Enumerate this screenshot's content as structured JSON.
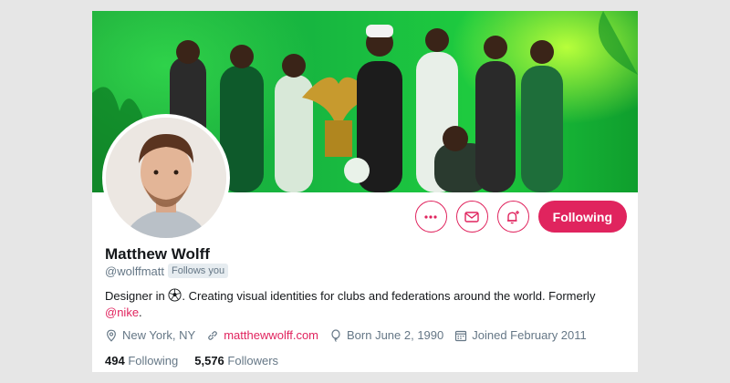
{
  "profile": {
    "name": "Matthew Wolff",
    "handle": "@wolffmatt",
    "follows_you": "Follows you",
    "bio_prefix": "Designer in",
    "bio_suffix": ". Creating visual identities for clubs and federations around the world. Formerly",
    "bio_mention": "@nike",
    "bio_end": "."
  },
  "actions": {
    "more_icon": "more-icon",
    "message_icon": "envelope-icon",
    "notify_icon": "bell-plus-icon",
    "follow_label": "Following"
  },
  "meta": {
    "location": "New York, NY",
    "website": "matthewwolff.com",
    "born": "Born June 2, 1990",
    "joined": "Joined February 2011"
  },
  "stats": {
    "following_count": "494",
    "following_label": "Following",
    "followers_count": "5,576",
    "followers_label": "Followers"
  },
  "colors": {
    "accent": "#e0245e",
    "secondary_text": "#657786",
    "banner_green": "#1ecb3f"
  }
}
